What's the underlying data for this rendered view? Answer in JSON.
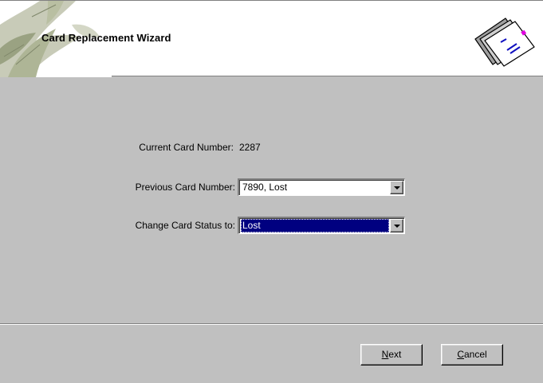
{
  "window": {
    "title": "Card Replacement Wizard"
  },
  "form": {
    "current_card": {
      "label": "Current Card Number:",
      "value": "2287"
    },
    "previous_card": {
      "label": "Previous Card Number:",
      "value": "7890, Lost"
    },
    "change_status": {
      "label": "Change Card Status to:",
      "value": "Lost"
    }
  },
  "buttons": {
    "next": {
      "mnemonic": "N",
      "rest": "ext"
    },
    "cancel": {
      "mnemonic": "C",
      "rest": "ancel"
    }
  },
  "icons": {
    "header_art": "leaf-decoration",
    "header_icon": "cards-icon",
    "dropdown": "chevron-down-icon"
  },
  "colors": {
    "background": "#c0c0c0",
    "selection": "#000080"
  }
}
